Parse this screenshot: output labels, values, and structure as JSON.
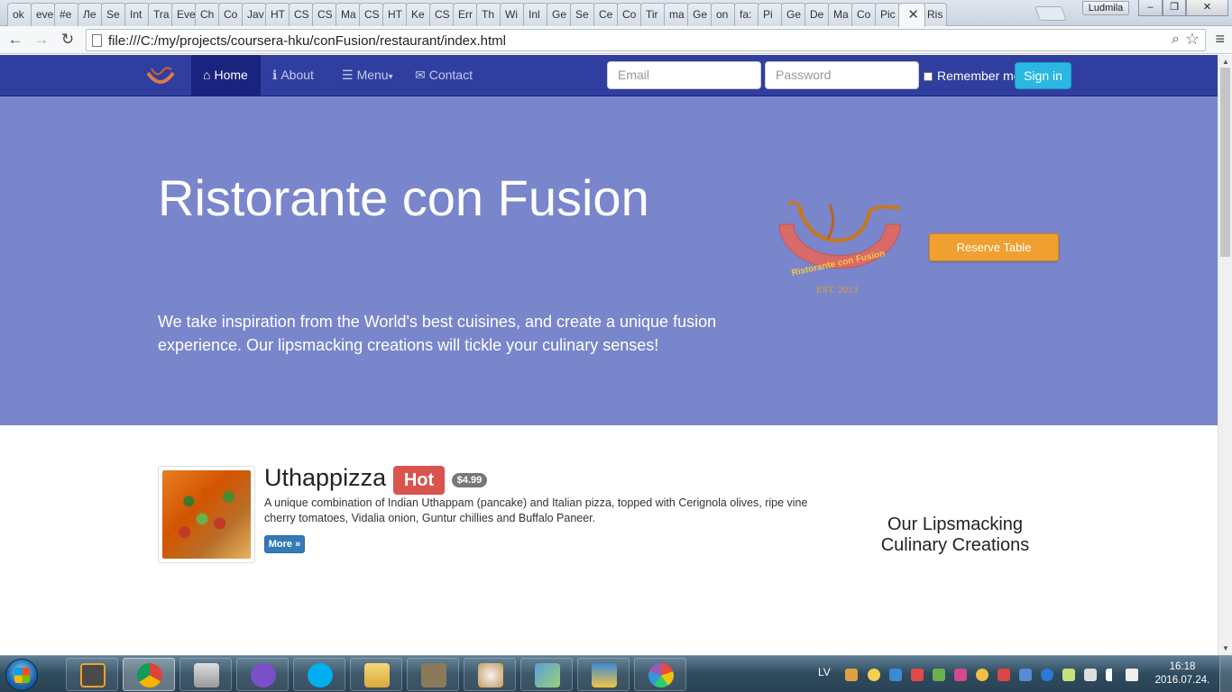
{
  "browser": {
    "tabs": [
      "ok",
      "eve",
      "#e",
      "Ле",
      "Se",
      "Int",
      "Tra",
      "Eve",
      "Ch",
      "Co",
      "Jav",
      "HT",
      "CS",
      "CS",
      "Ma",
      "CS",
      "HT",
      "Ke",
      "CS",
      "Err",
      "Th",
      "Wi",
      "Inl",
      "Ge",
      "Se",
      "Ce",
      "Co",
      "Tir",
      "ma",
      "Ge",
      "on",
      "fa:",
      "Pi",
      "Ge",
      "De",
      "Ma",
      "Co",
      "Pic",
      "",
      "Ris"
    ],
    "active_tab_index": 38,
    "user_name": "Ludmila",
    "url": "file:///C:/my/projects/coursera-hku/conFusion/restaurant/index.html",
    "window_buttons": [
      "–",
      "❐",
      "✕"
    ]
  },
  "navbar": {
    "links": [
      {
        "label": "Home",
        "icon": "home-icon",
        "glyph": "⌂"
      },
      {
        "label": "About",
        "icon": "info-icon",
        "glyph": "ℹ"
      },
      {
        "label": "Menu",
        "icon": "list-icon",
        "glyph": "☰",
        "caret": "▾"
      },
      {
        "label": "Contact",
        "icon": "envelope-icon",
        "glyph": "✉"
      }
    ],
    "email_placeholder": "Email",
    "password_placeholder": "Password",
    "remember_label": "Remember me",
    "signin_label": "Sign in"
  },
  "jumbotron": {
    "title": "Ristorante con Fusion",
    "lead": "We take inspiration from the World's best cuisines, and create a unique fusion experience. Our lipsmacking creations will tickle your culinary senses!",
    "logo_text": "Ristorante con Fusion",
    "logo_est": "EST. 2013",
    "reserve_label": "Reserve Table"
  },
  "featured": {
    "name": "Uthappizza",
    "badge": "Hot",
    "price": "$4.99",
    "description": "A unique combination of Indian Uthappam (pancake) and Italian pizza, topped with Cerignola olives, ripe vine cherry tomatoes, Vidalia onion, Guntur chillies and Buffalo Paneer.",
    "more_label": "More »"
  },
  "aside": {
    "title": "Our Lipsmacking Culinary Creations"
  },
  "taskbar": {
    "language": "LV",
    "time": "16:18",
    "date": "2016.07.24."
  },
  "colors": {
    "navbar": "#303f9f",
    "navbar_active": "#1a237e",
    "jumbotron": "#7986cb",
    "reserve": "#f0a030",
    "signin": "#2ab7e2",
    "hot_badge": "#d9534f",
    "more_button": "#337ab7"
  }
}
